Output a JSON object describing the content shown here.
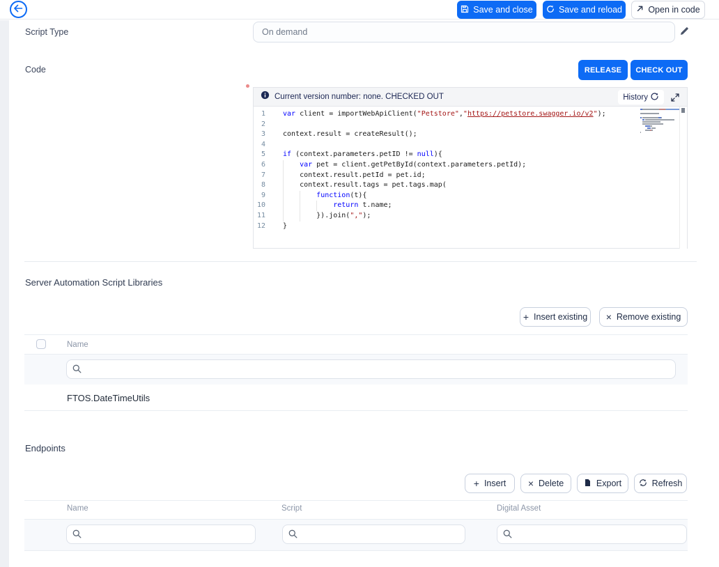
{
  "topbar": {
    "save_close": "Save and close",
    "save_reload": "Save and reload",
    "open_in_code": "Open in code"
  },
  "form": {
    "script_type_label": "Script Type",
    "script_type_value": "On demand",
    "code_label": "Code",
    "release_label": "RELEASE",
    "check_out_label": "CHECK OUT"
  },
  "code_editor": {
    "status_text": "Current version number: none. CHECKED OUT",
    "history_label": "History",
    "lines": [
      {
        "n": 1,
        "g": 0,
        "t": [
          {
            "c": "kw",
            "v": "var"
          },
          {
            "c": "pl",
            "v": " client = importWebApiClient("
          },
          {
            "c": "str",
            "v": "\"Petstore\""
          },
          {
            "c": "pl",
            "v": ","
          },
          {
            "c": "str",
            "v": "\""
          },
          {
            "c": "lnk",
            "v": "https://petstore.swagger.io/v2"
          },
          {
            "c": "str",
            "v": "\""
          },
          {
            "c": "pl",
            "v": ");"
          }
        ]
      },
      {
        "n": 2,
        "g": 0,
        "t": [
          {
            "c": "pl",
            "v": ""
          }
        ]
      },
      {
        "n": 3,
        "g": 0,
        "t": [
          {
            "c": "pl",
            "v": "context.result = createResult();"
          }
        ]
      },
      {
        "n": 4,
        "g": 0,
        "t": [
          {
            "c": "pl",
            "v": ""
          }
        ]
      },
      {
        "n": 5,
        "g": 0,
        "t": [
          {
            "c": "kw",
            "v": "if"
          },
          {
            "c": "pl",
            "v": " (context.parameters.petID != "
          },
          {
            "c": "kw",
            "v": "null"
          },
          {
            "c": "pl",
            "v": "){"
          }
        ]
      },
      {
        "n": 6,
        "g": 1,
        "t": [
          {
            "c": "pl",
            "v": "    "
          },
          {
            "c": "kw",
            "v": "var"
          },
          {
            "c": "pl",
            "v": " pet = client.getPetById(context.parameters.petId);"
          }
        ]
      },
      {
        "n": 7,
        "g": 1,
        "t": [
          {
            "c": "pl",
            "v": "    context.result.petId = pet.id;"
          }
        ]
      },
      {
        "n": 8,
        "g": 1,
        "t": [
          {
            "c": "pl",
            "v": "    context.result.tags = pet.tags.map("
          }
        ]
      },
      {
        "n": 9,
        "g": 2,
        "t": [
          {
            "c": "pl",
            "v": "        "
          },
          {
            "c": "kw",
            "v": "function"
          },
          {
            "c": "pl",
            "v": "(t){"
          }
        ]
      },
      {
        "n": 10,
        "g": 3,
        "t": [
          {
            "c": "pl",
            "v": "            "
          },
          {
            "c": "kw",
            "v": "return"
          },
          {
            "c": "pl",
            "v": " t.name;"
          }
        ]
      },
      {
        "n": 11,
        "g": 2,
        "t": [
          {
            "c": "pl",
            "v": "        }).join("
          },
          {
            "c": "str",
            "v": "\",\""
          },
          {
            "c": "pl",
            "v": ");"
          }
        ]
      },
      {
        "n": 12,
        "g": 0,
        "t": [
          {
            "c": "pl",
            "v": "}"
          }
        ]
      }
    ]
  },
  "libraries": {
    "title": "Server Automation Script Libraries",
    "insert_label": "Insert existing",
    "remove_label": "Remove existing",
    "columns": [
      "Name"
    ],
    "rows": [
      "FTOS.DateTimeUtils"
    ]
  },
  "endpoints": {
    "title": "Endpoints",
    "insert_label": "Insert",
    "delete_label": "Delete",
    "export_label": "Export",
    "refresh_label": "Refresh",
    "columns": [
      "Name",
      "Script",
      "Digital Asset"
    ]
  },
  "icons": {
    "back-icon": "left arrow in blue circle",
    "save-icon": "floppy disk",
    "reload-icon": "circular arrow",
    "open-external-icon": "arrow up-right",
    "edit-pencil-icon": "pencil",
    "info-icon": "filled i circle",
    "history-icon": "counterclockwise arrow",
    "expand-icon": "diagonal resize arrows",
    "plus-icon": "+",
    "close-icon": "×",
    "export-file-icon": "document page",
    "refresh-icon": "circular arrows",
    "search-icon": "magnifier"
  },
  "colors": {
    "accent_blue": "#0d6bf5",
    "editor_keyword": "#0000ff",
    "editor_string": "#a31515",
    "header_bg": "#f4f5f7",
    "filter_row_bg": "#f7f9fc",
    "required_dot": "#eb8b8b"
  }
}
